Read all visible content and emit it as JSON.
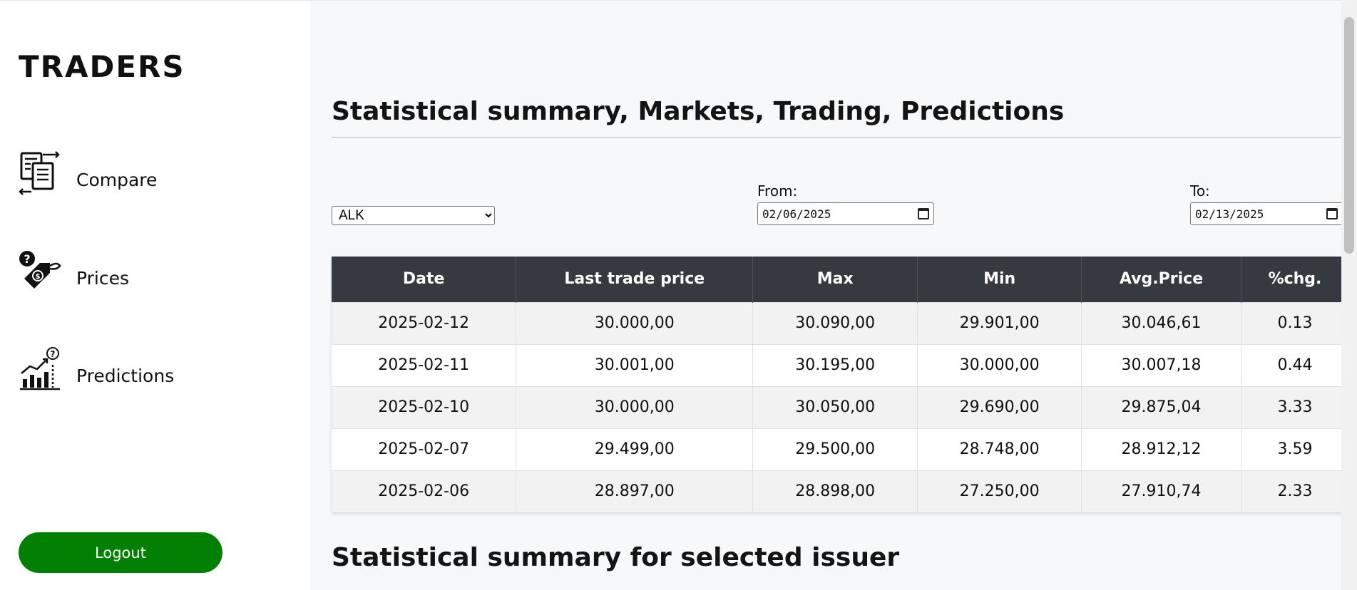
{
  "sidebar": {
    "brand": "TRADERS",
    "items": [
      {
        "label": "Compare",
        "icon": "compare-document-icon"
      },
      {
        "label": "Prices",
        "icon": "price-tag-icon"
      },
      {
        "label": "Predictions",
        "icon": "predictions-chart-icon"
      }
    ],
    "logout_label": "Logout"
  },
  "main": {
    "title": "Statistical summary, Markets, Trading, Predictions",
    "issuer": {
      "selected": "ALK"
    },
    "from": {
      "label": "From:",
      "value": "02/06/2025"
    },
    "to": {
      "label": "To:",
      "value": "02/13/2025"
    },
    "table": {
      "headers": [
        "Date",
        "Last trade price",
        "Max",
        "Min",
        "Avg.Price",
        "%chg."
      ],
      "rows": [
        [
          "2025-02-12",
          "30.000,00",
          "30.090,00",
          "29.901,00",
          "30.046,61",
          "0.13"
        ],
        [
          "2025-02-11",
          "30.001,00",
          "30.195,00",
          "30.000,00",
          "30.007,18",
          "0.44"
        ],
        [
          "2025-02-10",
          "30.000,00",
          "30.050,00",
          "29.690,00",
          "29.875,04",
          "3.33"
        ],
        [
          "2025-02-07",
          "29.499,00",
          "29.500,00",
          "28.748,00",
          "28.912,12",
          "3.59"
        ],
        [
          "2025-02-06",
          "28.897,00",
          "28.898,00",
          "27.250,00",
          "27.910,74",
          "2.33"
        ]
      ]
    },
    "section2_title": "Statistical summary for selected issuer"
  },
  "colors": {
    "accent": "#028003",
    "table_header": "#343a40",
    "page_background": "#f7f8f9"
  }
}
